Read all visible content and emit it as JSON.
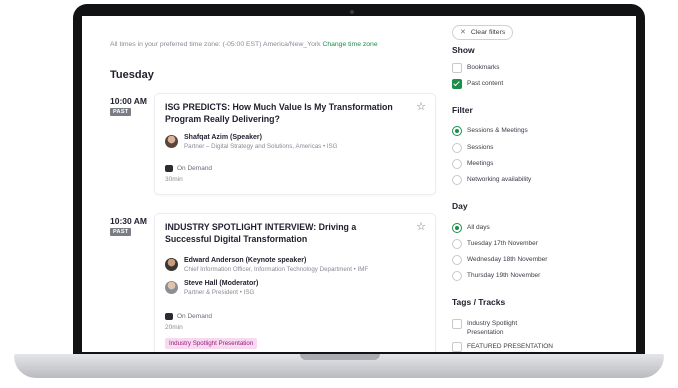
{
  "timezone": {
    "notice": "All times in your preferred time zone: (-05:00 EST) America/New_York",
    "change_link": "Change time zone"
  },
  "day_heading": "Tuesday",
  "sessions": [
    {
      "time": "10:00 AM",
      "badge": "PAST",
      "title": "ISG PREDICTS: How Much Value Is My Transformation Program Really Delivering?",
      "speakers": [
        {
          "name": "Shafqat Azim (Speaker)",
          "role": "Partner – Digital Strategy and Solutions, Americas • ISG"
        }
      ],
      "availability": "On Demand",
      "duration": "30min"
    },
    {
      "time": "10:30 AM",
      "badge": "PAST",
      "title": "INDUSTRY SPOTLIGHT INTERVIEW: Driving a Successful Digital Transformation",
      "speakers": [
        {
          "name": "Edward Anderson (Keynote speaker)",
          "role": "Chief Information Officer, Information Technology Department • IMF"
        },
        {
          "name": "Steve Hall (Moderator)",
          "role": "Partner & President • ISG"
        }
      ],
      "availability": "On Demand",
      "duration": "20min",
      "tag": "Industry Spotlight Presentation"
    }
  ],
  "filters": {
    "clear_label": "Clear filters",
    "show": {
      "heading": "Show",
      "options": [
        {
          "label": "Bookmarks",
          "checked": false
        },
        {
          "label": "Past content",
          "checked": true
        }
      ]
    },
    "filter": {
      "heading": "Filter",
      "options": [
        {
          "label": "Sessions & Meetings",
          "checked": true
        },
        {
          "label": "Sessions",
          "checked": false
        },
        {
          "label": "Meetings",
          "checked": false
        },
        {
          "label": "Networking availability",
          "checked": false
        }
      ]
    },
    "day": {
      "heading": "Day",
      "options": [
        {
          "label": "All days",
          "checked": true
        },
        {
          "label": "Tuesday 17th November",
          "checked": false
        },
        {
          "label": "Wednesday 18th November",
          "checked": false
        },
        {
          "label": "Thursday 19th November",
          "checked": false
        }
      ]
    },
    "tags": {
      "heading": "Tags / Tracks",
      "options": [
        {
          "label": "Industry Spotlight Presentation",
          "checked": false
        },
        {
          "label": "FEATURED PRESENTATION",
          "checked": false
        }
      ]
    }
  },
  "colors": {
    "accent": "#1a8f4a",
    "past_badge": "#7b7d86",
    "tag_bg": "#f7d9f0",
    "tag_text": "#9b1c7c"
  }
}
